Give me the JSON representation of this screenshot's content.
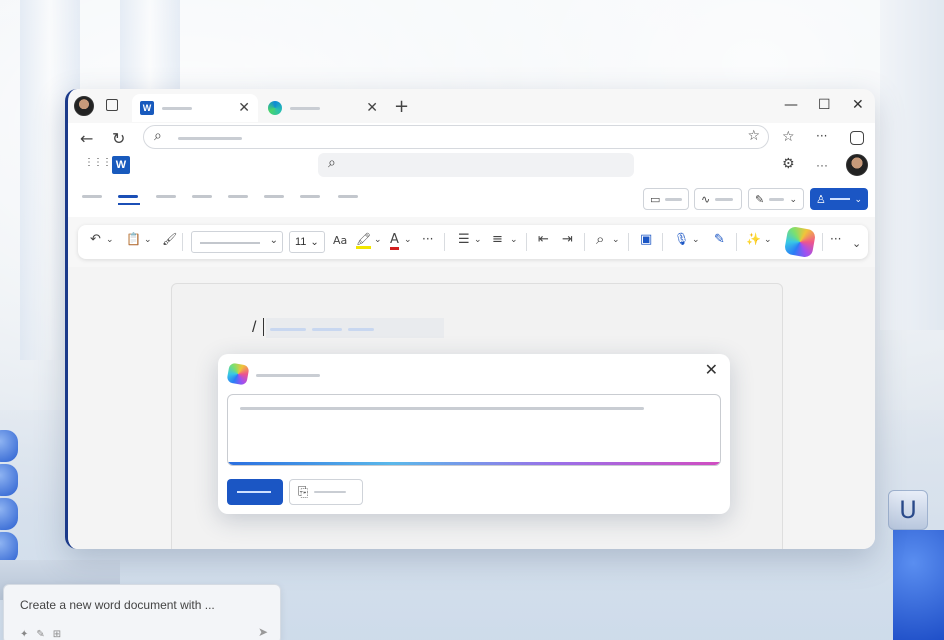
{
  "tabs": {
    "word_tab_icon": "W",
    "close_glyph": "✕",
    "new_tab_glyph": "+"
  },
  "window_controls": {
    "minimize": "—",
    "maximize": "☐",
    "close": "✕"
  },
  "nav": {
    "back": "←",
    "refresh": "↻",
    "search": "⌕",
    "favorite": "☆",
    "favorites": "☆",
    "more": "···"
  },
  "appbar": {
    "app_grid": "⋮⋮⋮",
    "word_logo": "W",
    "search": "⌕",
    "settings": "⚙",
    "more": "···"
  },
  "toolbar": {
    "undo": "↶",
    "paste": "📋",
    "format_painter": "🖌",
    "font_size": "11",
    "text_case": "Aa",
    "highlight": "🖍",
    "font_color": "A",
    "more": "···",
    "bullets": "☰",
    "align": "≡",
    "outdent": "⇤",
    "indent": "⇥",
    "find": "⌕",
    "view": "▣",
    "dictate": "🎙",
    "editor": "✎",
    "designer": "✨",
    "overflow": "···",
    "chevron": "⌄"
  },
  "document": {
    "slash": "/"
  },
  "copilot_card": {
    "close": "✕"
  },
  "chat": {
    "prompt_text": "Create a new word document with ...",
    "icons": [
      "✦",
      "✎",
      "⊞"
    ],
    "send": "➤"
  },
  "background": {
    "key_label": "U"
  },
  "colors": {
    "accent": "#1b56c4",
    "word_blue": "#185abd"
  }
}
